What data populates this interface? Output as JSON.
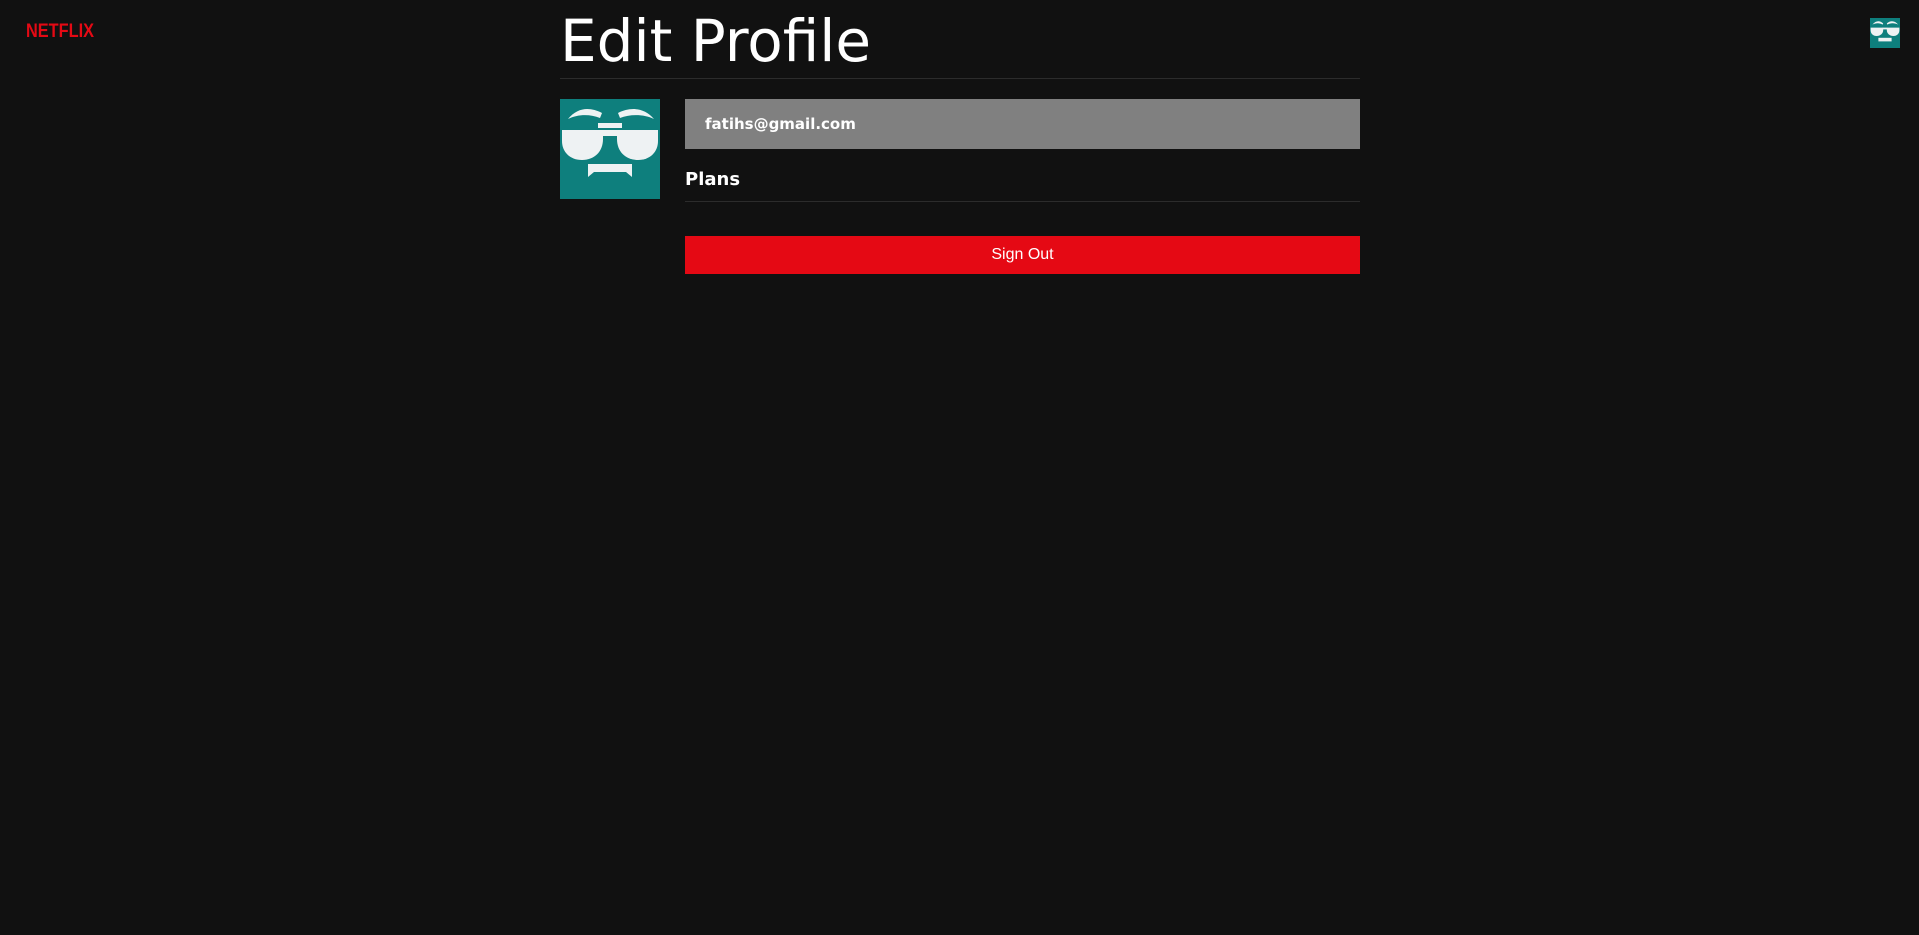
{
  "header": {
    "logo_text": "NETFLIX",
    "logo_color": "#e50914",
    "avatar_icon": "sunglasses-face-icon"
  },
  "profile": {
    "title": "Edit Profile",
    "avatar_icon": "sunglasses-face-icon",
    "avatar_color": "#0e7f7d",
    "email": "fatihs@gmail.com",
    "plans_heading": "Plans",
    "signout_label": "Sign Out",
    "signout_color": "#e50914"
  }
}
